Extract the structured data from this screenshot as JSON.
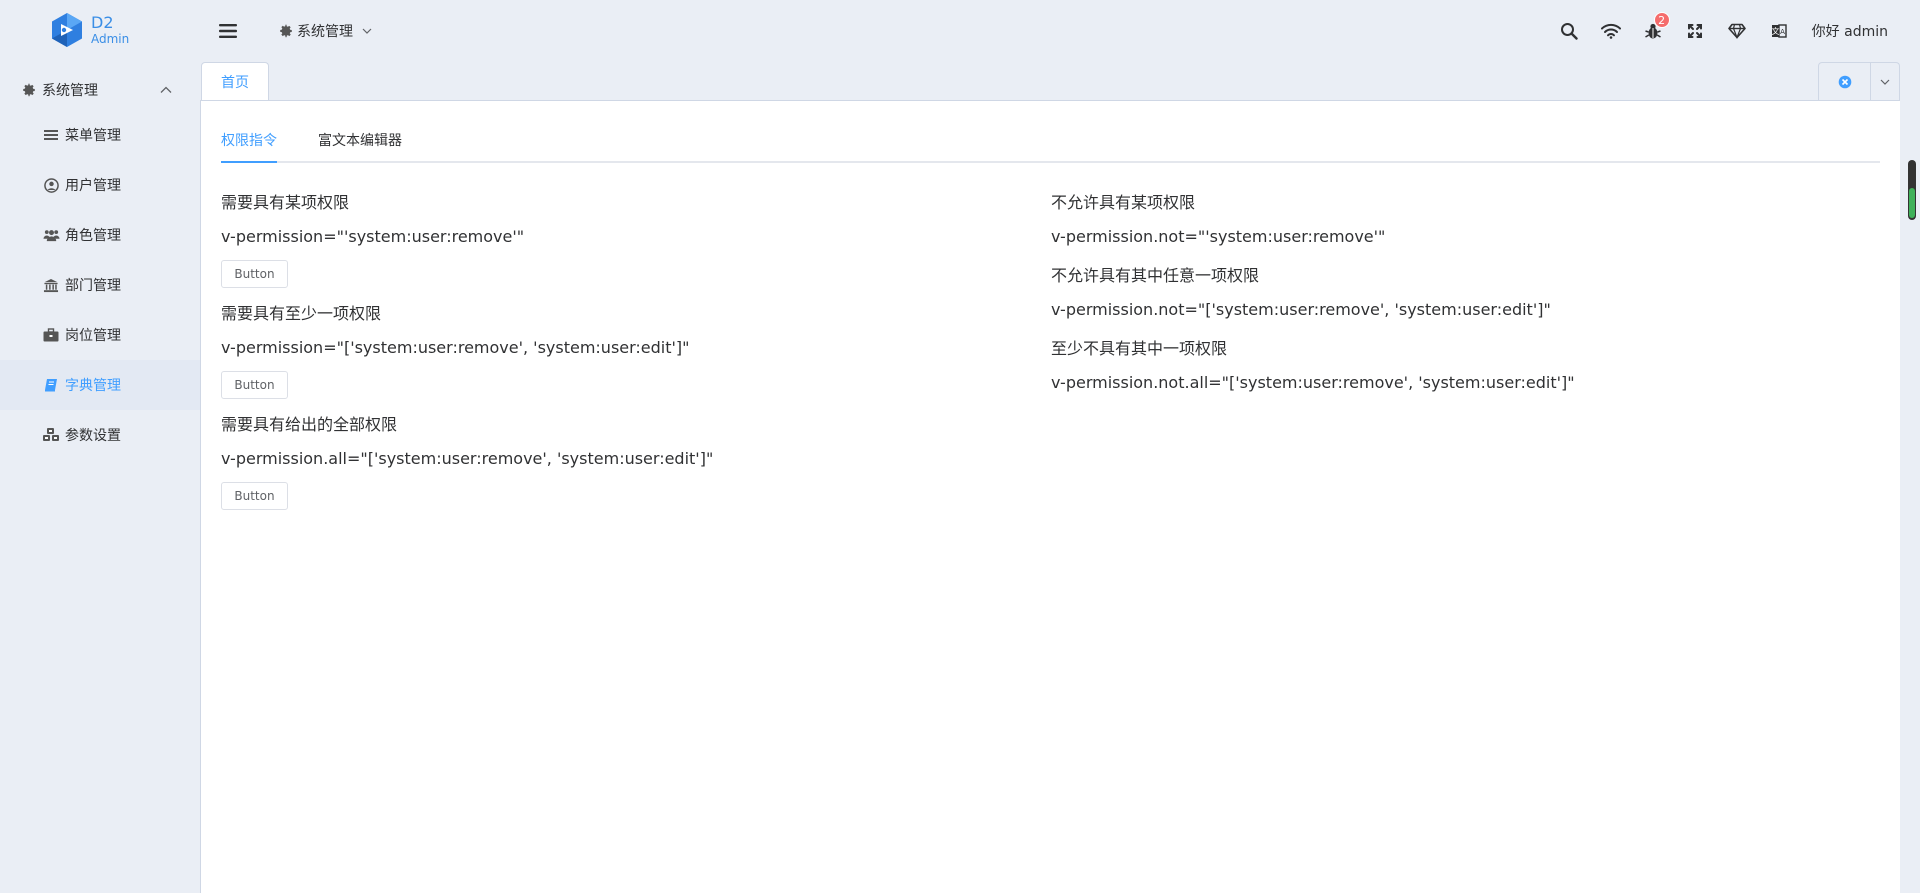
{
  "logo": {
    "title": "D2",
    "subtitle": "Admin"
  },
  "header": {
    "menu_label": "系统管理",
    "notification_count": "2",
    "user_greeting": "你好 admin"
  },
  "sidebar": {
    "group_label": "系统管理",
    "items": [
      {
        "label": "菜单管理",
        "icon": "list-icon"
      },
      {
        "label": "用户管理",
        "icon": "user-circle-icon"
      },
      {
        "label": "角色管理",
        "icon": "users-icon"
      },
      {
        "label": "部门管理",
        "icon": "institution-icon"
      },
      {
        "label": "岗位管理",
        "icon": "briefcase-icon"
      },
      {
        "label": "字典管理",
        "icon": "book-icon",
        "active": true
      },
      {
        "label": "参数设置",
        "icon": "cubes-icon"
      }
    ]
  },
  "tabs": {
    "home": "首页"
  },
  "content": {
    "subtabs": [
      "权限指令",
      "富文本编辑器"
    ],
    "left": [
      {
        "title": "需要具有某项权限",
        "code": "v-permission=\"'system:user:remove'\"",
        "button": "Button"
      },
      {
        "title": "需要具有至少一项权限",
        "code": "v-permission=\"['system:user:remove', 'system:user:edit']\"",
        "button": "Button"
      },
      {
        "title": "需要具有给出的全部权限",
        "code": "v-permission.all=\"['system:user:remove', 'system:user:edit']\"",
        "button": "Button"
      }
    ],
    "right": [
      {
        "title": "不允许具有某项权限",
        "code": "v-permission.not=\"'system:user:remove'\""
      },
      {
        "title": "不允许具有其中任意一项权限",
        "code": "v-permission.not=\"['system:user:remove', 'system:user:edit']\""
      },
      {
        "title": "至少不具有其中一项权限",
        "code": "v-permission.not.all=\"['system:user:remove', 'system:user:edit']\""
      }
    ]
  },
  "colors": {
    "primary": "#409eff",
    "background": "#eaeef5",
    "badge": "#f56c6c"
  }
}
